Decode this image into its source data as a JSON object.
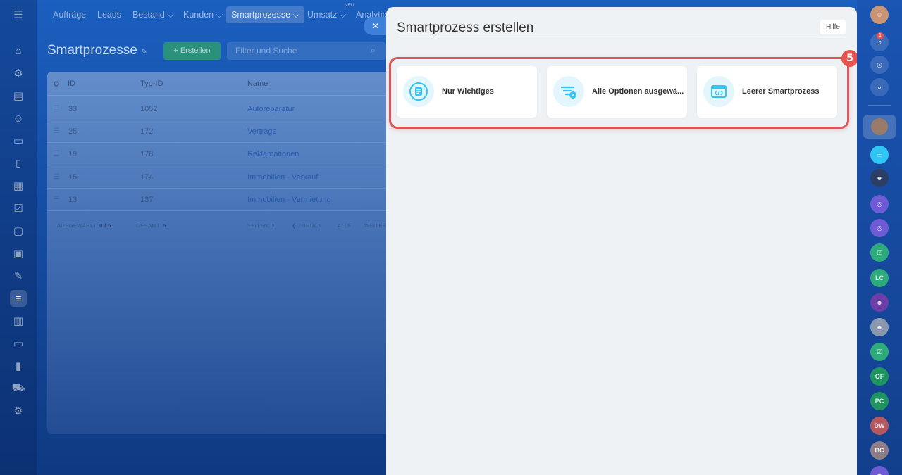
{
  "topnav": {
    "items": [
      {
        "label": "Aufträge"
      },
      {
        "label": "Leads"
      },
      {
        "label": "Bestand ⌵"
      },
      {
        "label": "Kunden ⌵"
      },
      {
        "label": "Smartprozesse ⌵"
      },
      {
        "label": "Umsatz ⌵"
      },
      {
        "label": "Analytic"
      }
    ],
    "new_badge": "NEU"
  },
  "page": {
    "title": "Smartprozesse",
    "create_button": "+ Erstellen",
    "filter_placeholder": "Filter und Suche"
  },
  "grid": {
    "columns": [
      "ID",
      "Typ-ID",
      "Name"
    ],
    "rows": [
      {
        "id": "33",
        "type_id": "1052",
        "name": "Autoreparatur"
      },
      {
        "id": "25",
        "type_id": "172",
        "name": "Verträge"
      },
      {
        "id": "19",
        "type_id": "178",
        "name": "Reklamationen"
      },
      {
        "id": "15",
        "type_id": "174",
        "name": "Immobilien - Verkauf"
      },
      {
        "id": "13",
        "type_id": "137",
        "name": "Immobilien - Vermietung"
      }
    ],
    "footer": {
      "selected_label": "AUSGEWÄHLT:",
      "selected_value": "0 / 5",
      "total_label": "GESAMT:",
      "total_value": "5",
      "pages_label": "SEITEN:",
      "pages_value": "1",
      "back": "❮ ZURÜCK",
      "all": "ALLE",
      "next": "WEITER"
    }
  },
  "panel": {
    "title": "Smartprozess erstellen",
    "help": "Hilfe",
    "step_badge": "5",
    "options": [
      {
        "label": "Nur Wichtiges",
        "icon": "document-list-icon"
      },
      {
        "label": "Alle Optionen ausgewä...",
        "icon": "filter-settings-icon"
      },
      {
        "label": "Leerer Smartprozess",
        "icon": "code-window-icon"
      }
    ]
  },
  "right_rail": {
    "notification_count": "1",
    "avatars": [
      "LC",
      "OF",
      "PC",
      "DW",
      "BC"
    ]
  },
  "colors": {
    "accent_blue": "#1b5fbf",
    "highlight_red": "#d95557",
    "create_green": "#2f9f6d",
    "icon_cyan": "#2fc6f6"
  }
}
